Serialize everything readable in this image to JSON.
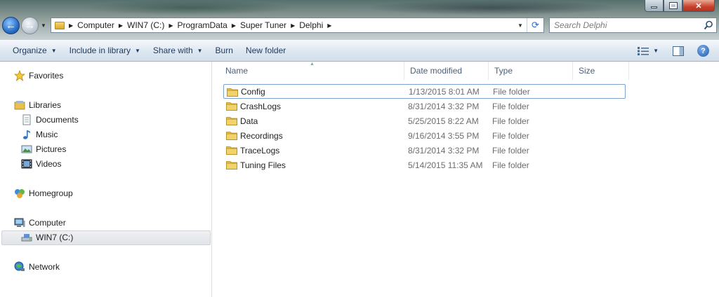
{
  "address": {
    "crumbs": [
      "Computer",
      "WIN7 (C:)",
      "ProgramData",
      "Super Tuner",
      "Delphi"
    ]
  },
  "search": {
    "placeholder": "Search Delphi"
  },
  "toolbar": {
    "organize": "Organize",
    "include_in_library": "Include in library",
    "share_with": "Share with",
    "burn": "Burn",
    "new_folder": "New folder"
  },
  "nav": {
    "favorites": "Favorites",
    "libraries": "Libraries",
    "documents": "Documents",
    "music": "Music",
    "pictures": "Pictures",
    "videos": "Videos",
    "homegroup": "Homegroup",
    "computer": "Computer",
    "drive": "WIN7 (C:)",
    "network": "Network"
  },
  "columns": {
    "name": "Name",
    "date_modified": "Date modified",
    "type": "Type",
    "size": "Size"
  },
  "files": [
    {
      "name": "Config",
      "date": "1/13/2015 8:01 AM",
      "type": "File folder"
    },
    {
      "name": "CrashLogs",
      "date": "8/31/2014 3:32 PM",
      "type": "File folder"
    },
    {
      "name": "Data",
      "date": "5/25/2015 8:22 AM",
      "type": "File folder"
    },
    {
      "name": "Recordings",
      "date": "9/16/2014 3:55 PM",
      "type": "File folder"
    },
    {
      "name": "TraceLogs",
      "date": "8/31/2014 3:32 PM",
      "type": "File folder"
    },
    {
      "name": "Tuning Files",
      "date": "5/14/2015 11:35 AM",
      "type": "File folder"
    }
  ],
  "colors": {
    "toolbar_text": "#1e395b",
    "column_header_text": "#4c607a",
    "focus_border": "#7da2ce",
    "folder_yellow": "#e8c04a"
  }
}
